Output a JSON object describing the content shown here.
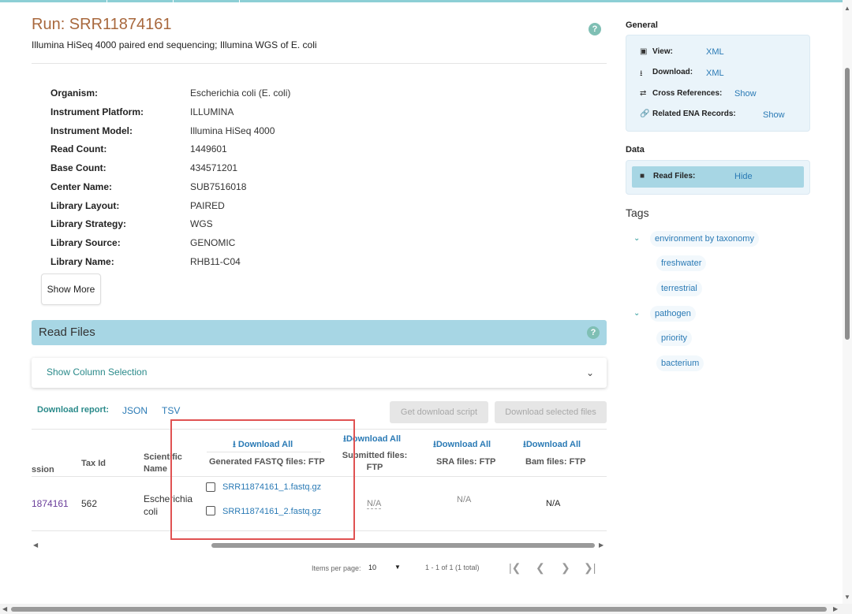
{
  "run": {
    "title": "Run: SRR11874161",
    "subtitle": "Illumina HiSeq 4000 paired end sequencing; Illumina WGS of E. coli"
  },
  "help_glyph": "?",
  "metadata": [
    {
      "label": "Organism:",
      "value": "Escherichia coli (E. coli)",
      "link": true
    },
    {
      "label": "Instrument Platform:",
      "value": "ILLUMINA"
    },
    {
      "label": "Instrument Model:",
      "value": "Illumina HiSeq 4000"
    },
    {
      "label": "Read Count:",
      "value": "1449601"
    },
    {
      "label": "Base Count:",
      "value": "434571201"
    },
    {
      "label": "Center Name:",
      "value": "SUB7516018"
    },
    {
      "label": "Library Layout:",
      "value": "PAIRED"
    },
    {
      "label": "Library Strategy:",
      "value": "WGS"
    },
    {
      "label": "Library Source:",
      "value": "GENOMIC"
    },
    {
      "label": "Library Name:",
      "value": "RHB11-C04"
    }
  ],
  "show_more_label": "Show More",
  "read_files": {
    "title": "Read Files",
    "column_selection_label": "Show Column Selection",
    "download_report_label": "Download report:",
    "report_json": "JSON",
    "report_tsv": "TSV",
    "get_script_label": "Get download script",
    "download_selected_label": "Download selected files",
    "download_all_label": "Download All",
    "columns": {
      "accession": "ssion",
      "tax_id": "Tax Id",
      "scientific_name_1": "Scientific",
      "scientific_name_2": "Name",
      "generated_fastq": "Generated FASTQ files: FTP",
      "submitted_1": "Submitted files:",
      "submitted_2": "FTP",
      "sra": "SRA files: FTP",
      "bam": "Bam files: FTP"
    },
    "row": {
      "accession": "1874161",
      "tax_id": "562",
      "scientific_name_1": "Escherichia",
      "scientific_name_2": "coli",
      "files": [
        "SRR11874161_1.fastq.gz",
        "SRR11874161_2.fastq.gz"
      ],
      "submitted": "N/A",
      "sra": "N/A",
      "bam": "N/A"
    },
    "pagination": {
      "items_per_page_label": "Items per page:",
      "items_per_page_value": "10",
      "range_text": "1 - 1 of 1 (1 total)"
    }
  },
  "sidebar": {
    "general_title": "General",
    "general_items": [
      {
        "icon": "view-icon",
        "label": "View:",
        "link": "XML"
      },
      {
        "icon": "download-icon",
        "label": "Download:",
        "link": "XML"
      },
      {
        "icon": "swap-icon",
        "label": "Cross References:",
        "link": "Show"
      },
      {
        "icon": "link-icon",
        "label": "Related ENA Records:",
        "link": "Show"
      }
    ],
    "data_title": "Data",
    "data_item": {
      "icon": "folder-icon",
      "label": "Read Files:",
      "link": "Hide"
    },
    "tags_title": "Tags",
    "tags": [
      {
        "label": "environment by taxonomy",
        "children": [
          "freshwater",
          "terrestrial"
        ]
      },
      {
        "label": "pathogen",
        "children": [
          "priority",
          "bacterium"
        ]
      }
    ]
  },
  "colors": {
    "title": "#a8683d",
    "accent_teal": "#2a8a8a",
    "link": "#2a7ab5",
    "read_files_bar": "#a7d6e4",
    "sidebar_box": "#eaf4fa",
    "highlight_box": "#e05252"
  }
}
